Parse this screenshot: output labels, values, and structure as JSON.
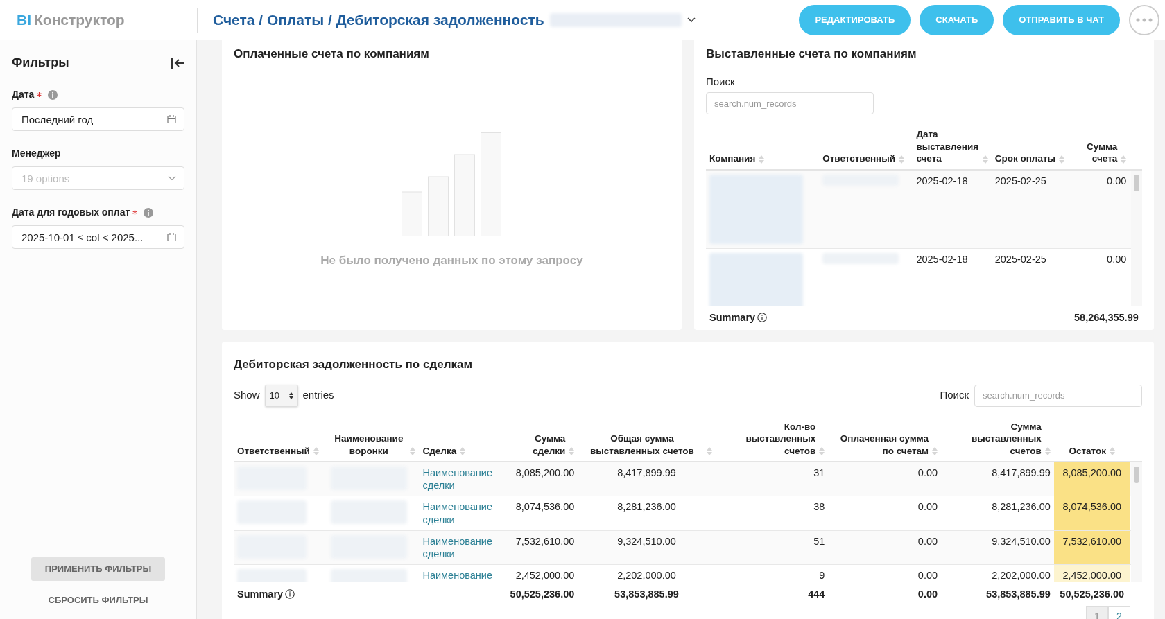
{
  "header": {
    "logo_prefix": "BI",
    "logo_name": "Конструктор",
    "breadcrumb": "Счета / Оплаты / Дебиторская задолженность",
    "actions": [
      "РЕДАКТИРОВАТЬ",
      "СКАЧАТЬ",
      "ОТПРАВИТЬ В ЧАТ"
    ]
  },
  "sidebar": {
    "title": "Фильтры",
    "filters": [
      {
        "kind": "date",
        "label": "Дата",
        "required": true,
        "info": true,
        "value": "Последний год"
      },
      {
        "kind": "select",
        "label": "Менеджер",
        "required": false,
        "info": false,
        "placeholder": "19 options"
      },
      {
        "kind": "date",
        "label": "Дата для годовых оплат",
        "required": true,
        "info": true,
        "value": "2025-10-01 ≤ col < 2025..."
      }
    ],
    "apply": "ПРИМЕНИТЬ ФИЛЬТРЫ",
    "reset": "СБРОСИТЬ ФИЛЬТРЫ"
  },
  "paid_panel": {
    "title": "Оплаченные счета по компаниям",
    "empty_message": "Не было получено данных по этому запросу"
  },
  "invoices_panel": {
    "title": "Выставленные счета по компаниям",
    "search_label": "Поиск",
    "search_placeholder": "search.num_records",
    "columns": [
      "Компания",
      "Ответственный",
      "Дата выставления счета",
      "Срок оплаты",
      "Сумма счета"
    ],
    "rows": [
      {
        "issued": "2025-02-18",
        "due": "2025-02-25",
        "sum": "0.00"
      },
      {
        "issued": "2025-02-18",
        "due": "2025-02-25",
        "sum": "0.00"
      }
    ],
    "summary": {
      "label": "Summary",
      "sum": "58,264,355.99"
    }
  },
  "deals_panel": {
    "title": "Дебиторская задолженность по сделкам",
    "show_label": "Show",
    "entries_value": "10",
    "entries_label": "entries",
    "search_label": "Поиск",
    "search_placeholder": "search.num_records",
    "columns": [
      "Ответственный",
      "Наименование воронки",
      "Сделка",
      "Сумма сделки",
      "Общая сумма выставленных счетов",
      "Кол-во выставленных счетов",
      "Оплаченная сумма по счетам",
      "Сумма выставленных счетов",
      "Остаток"
    ],
    "rows": [
      {
        "deal": "Наименование сделки",
        "deal_sum": "8,085,200.00",
        "total_invoiced": "8,417,899.99",
        "count": "31",
        "paid": "0.00",
        "invoiced_sum": "8,417,899.99",
        "remainder": "8,085,200.00",
        "color": "#fae186"
      },
      {
        "deal": "Наименование сделки",
        "deal_sum": "8,074,536.00",
        "total_invoiced": "8,281,236.00",
        "count": "38",
        "paid": "0.00",
        "invoiced_sum": "8,281,236.00",
        "remainder": "8,074,536.00",
        "color": "#fae186"
      },
      {
        "deal": "Наименование сделки",
        "deal_sum": "7,532,610.00",
        "total_invoiced": "9,324,510.00",
        "count": "51",
        "paid": "0.00",
        "invoiced_sum": "9,324,510.00",
        "remainder": "7,532,610.00",
        "color": "#fae186"
      },
      {
        "deal": "Наименование",
        "deal_sum": "2,452,000.00",
        "total_invoiced": "2,202,000.00",
        "count": "9",
        "paid": "0.00",
        "invoiced_sum": "2,202,000.00",
        "remainder": "2,452,000.00",
        "color": "#fdf4cf"
      }
    ],
    "summary": {
      "label": "Summary",
      "deal_sum": "50,525,236.00",
      "total_invoiced": "53,853,885.99",
      "count": "444",
      "paid": "0.00",
      "invoiced_sum": "53,853,885.99",
      "remainder": "50,525,236.00"
    },
    "pages": [
      {
        "label": "1",
        "selected": true
      },
      {
        "label": "2",
        "selected": false
      }
    ]
  }
}
